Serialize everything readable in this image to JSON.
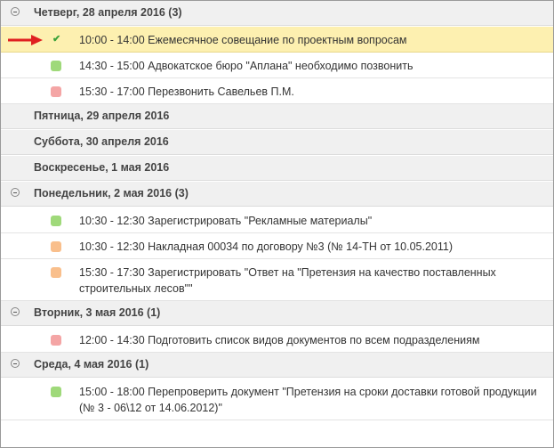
{
  "days": [
    {
      "label": "Четверг, 28 апреля 2016 (3)",
      "expanded": true,
      "tasks": [
        {
          "text": "10:00 - 14:00 Ежемесячное совещание по проектным вопросам",
          "status": "done",
          "selected": true
        },
        {
          "text": "14:30 - 15:00 Адвокатское бюро \"Аплана\" необходимо позвонить",
          "color": "#9fd97a"
        },
        {
          "text": "15:30 - 17:00 Перезвонить Савельев П.М.",
          "color": "#f4a5a5"
        }
      ]
    },
    {
      "label": "Пятница, 29 апреля 2016",
      "expanded": false,
      "tasks": []
    },
    {
      "label": "Суббота, 30 апреля 2016",
      "expanded": false,
      "tasks": []
    },
    {
      "label": "Воскресенье, 1 мая 2016",
      "expanded": false,
      "tasks": []
    },
    {
      "label": "Понедельник, 2 мая 2016 (3)",
      "expanded": true,
      "tasks": [
        {
          "text": "10:30 - 12:30 Зарегистрировать \"Рекламные материалы\"",
          "color": "#9fd97a"
        },
        {
          "text": "10:30 - 12:30 Накладная 00034 по договору №3 (№ 14-ТН от 10.05.2011)",
          "color": "#f9bf8c"
        },
        {
          "text": "15:30 - 17:30 Зарегистрировать \"Ответ на \"Претензия на качество поставленных строительных лесов\"\"",
          "color": "#f9bf8c",
          "lines": 2
        }
      ]
    },
    {
      "label": "Вторник, 3 мая 2016 (1)",
      "expanded": true,
      "tasks": [
        {
          "text": "12:00 - 14:30 Подготовить список видов документов по всем подразделениям",
          "color": "#f4a5a5"
        }
      ]
    },
    {
      "label": "Среда, 4 мая 2016 (1)",
      "expanded": true,
      "tasks": [
        {
          "text": "15:00 - 18:00 Перепроверить документ \"Претензия на сроки доставки готовой продукции (№ 3 - 06\\12 от 14.06.2012)\"",
          "color": "#9fd97a",
          "lines": 2
        }
      ]
    }
  ],
  "marker": {
    "color": "#e02020",
    "icon": "red-arrow-icon"
  },
  "done_icon": {
    "glyph": "✔",
    "color": "#3aa23a"
  }
}
